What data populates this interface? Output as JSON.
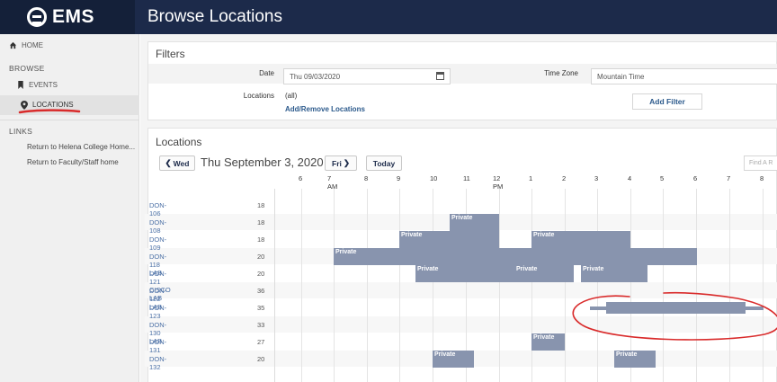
{
  "app": {
    "logo_text": "EMS",
    "page_title": "Browse Locations"
  },
  "sidebar": {
    "home_label": "HOME",
    "browse_label": "BROWSE",
    "events_label": "EVENTS",
    "locations_label": "LOCATIONS",
    "links_label": "LINKS",
    "links": [
      "Return to Helena College Home...",
      "Return to Faculty/Staff home"
    ]
  },
  "filters": {
    "title": "Filters",
    "date_label": "Date",
    "date_value": "Thu 09/03/2020",
    "timezone_label": "Time Zone",
    "timezone_value": "Mountain Time",
    "locations_label": "Locations",
    "locations_value": "(all)",
    "add_remove_label": "Add/Remove Locations",
    "add_filter_label": "Add Filter"
  },
  "locations": {
    "title": "Locations",
    "prev_label": "Wed",
    "date_text": "Thu September 3, 2020",
    "next_label": "Fri",
    "today_label": "Today",
    "find_placeholder": "Find A R"
  },
  "timeline": {
    "hours": [
      "6",
      "7 AM",
      "8",
      "9",
      "10",
      "11",
      "12 PM",
      "1",
      "2",
      "3",
      "4",
      "5",
      "6",
      "7",
      "8"
    ],
    "rooms": [
      {
        "name": "DON-106",
        "capacity": "18"
      },
      {
        "name": "DON-108",
        "capacity": "18"
      },
      {
        "name": "DON-109",
        "capacity": "18"
      },
      {
        "name": "DON-118 LAB",
        "capacity": "20"
      },
      {
        "name": "DON-121 CISCO LAB",
        "capacity": "20"
      },
      {
        "name": "DON-122 LAB",
        "capacity": "36"
      },
      {
        "name": "DON-123",
        "capacity": "35"
      },
      {
        "name": "DON-130 LAB",
        "capacity": "33"
      },
      {
        "name": "DON-131",
        "capacity": "27"
      },
      {
        "name": "DON-132",
        "capacity": "20"
      }
    ],
    "private_label": "Private"
  },
  "colors": {
    "topbar": "#1c2a4a",
    "booking": "#8894ae",
    "annotation": "#d92b2b",
    "link": "#4a6fa5"
  }
}
